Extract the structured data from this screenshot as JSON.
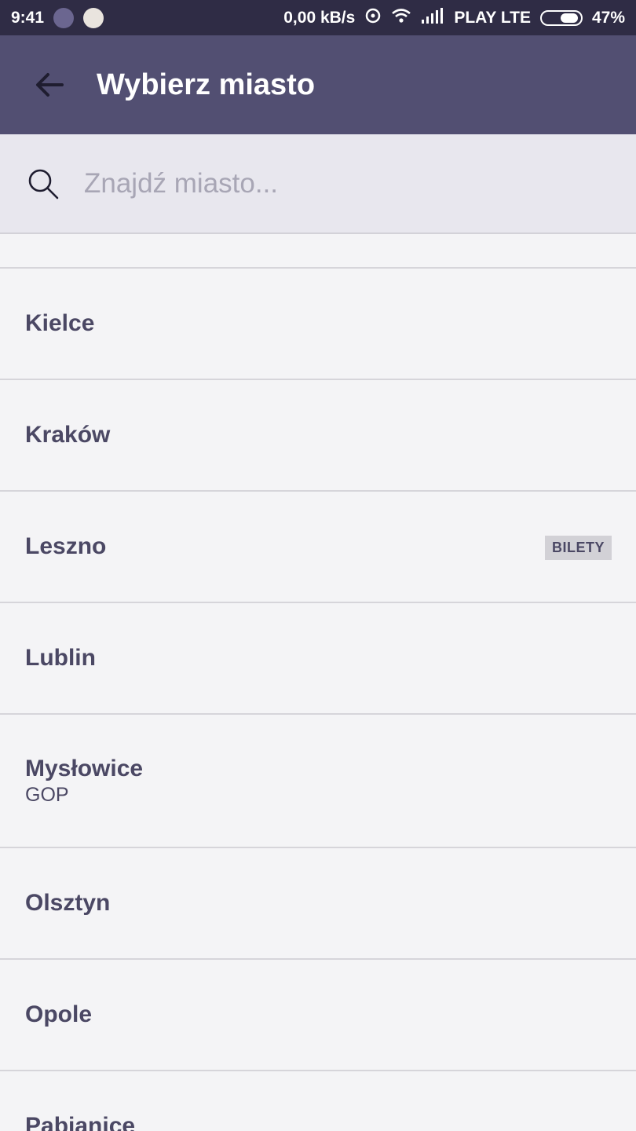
{
  "status_bar": {
    "time": "9:41",
    "speed": "0,00 kB/s",
    "carrier": "PLAY LTE",
    "battery": "47%"
  },
  "app_bar": {
    "title": "Wybierz miasto"
  },
  "search": {
    "placeholder": "Znajdź miasto..."
  },
  "cities": [
    {
      "name": "Kielce"
    },
    {
      "name": "Kraków"
    },
    {
      "name": "Leszno",
      "badge": "BILETY"
    },
    {
      "name": "Lublin"
    },
    {
      "name": "Mysłowice",
      "subtitle": "GOP"
    },
    {
      "name": "Olsztyn"
    },
    {
      "name": "Opole"
    },
    {
      "name": "Pabianice"
    }
  ]
}
